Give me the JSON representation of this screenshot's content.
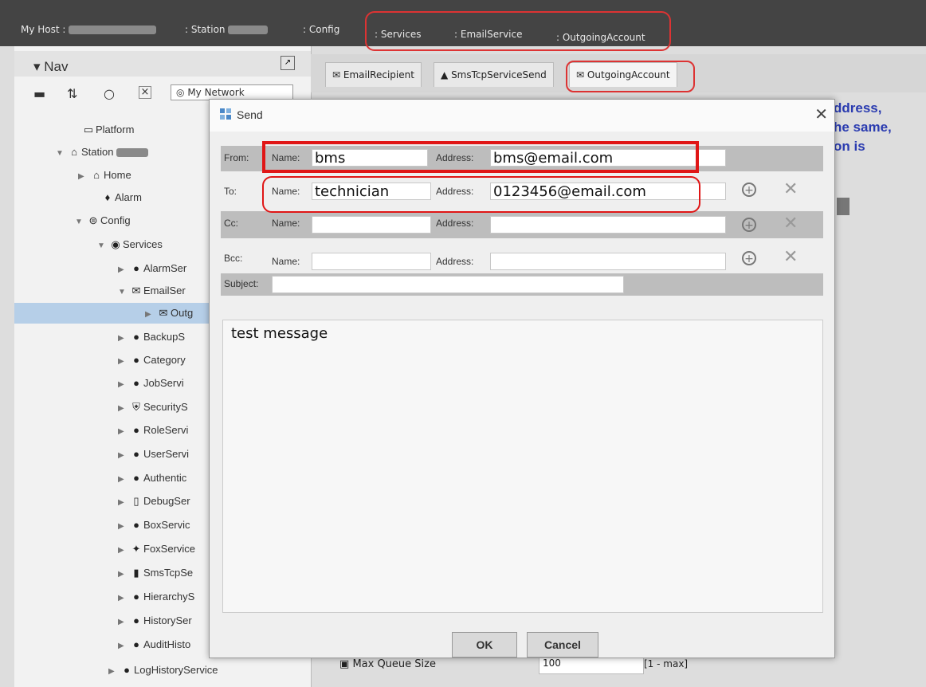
{
  "topbar": {
    "my_host": "My Host :",
    "station": ": Station",
    "config": ": Config",
    "services": ": Services",
    "email_service": ": EmailService",
    "outgoing_account": ": OutgoingAccount"
  },
  "nav": {
    "title": "Nav",
    "network": "My Network",
    "tree": [
      {
        "label": "Platform",
        "icon": "platform-icon"
      },
      {
        "label": "Station",
        "icon": "station-icon"
      },
      {
        "label": "Home",
        "icon": "home-icon"
      },
      {
        "label": "Alarm",
        "icon": "alarm-icon"
      },
      {
        "label": "Config",
        "icon": "config-icon"
      },
      {
        "label": "Services",
        "icon": "services-icon"
      },
      {
        "label": "AlarmSer",
        "icon": "service-icon"
      },
      {
        "label": "EmailSer",
        "icon": "email-icon"
      },
      {
        "label": "Outg",
        "icon": "outgoing-account-icon"
      },
      {
        "label": "BackupS",
        "icon": "service-icon"
      },
      {
        "label": "Category",
        "icon": "service-icon"
      },
      {
        "label": "JobServi",
        "icon": "service-icon"
      },
      {
        "label": "SecurityS",
        "icon": "shield-icon"
      },
      {
        "label": "RoleServi",
        "icon": "service-icon"
      },
      {
        "label": "UserServi",
        "icon": "service-icon"
      },
      {
        "label": "Authentic",
        "icon": "service-icon"
      },
      {
        "label": "DebugSer",
        "icon": "debug-icon"
      },
      {
        "label": "BoxServic",
        "icon": "service-icon"
      },
      {
        "label": "FoxService",
        "icon": "fox-icon"
      },
      {
        "label": "SmsTcpSe",
        "icon": "phone-icon"
      },
      {
        "label": "HierarchyS",
        "icon": "service-icon"
      },
      {
        "label": "HistorySer",
        "icon": "service-icon"
      },
      {
        "label": "AuditHisto",
        "icon": "service-icon"
      },
      {
        "label": "LogHistoryService",
        "icon": "service-icon"
      }
    ]
  },
  "tabs": [
    {
      "label": "EmailRecipient"
    },
    {
      "label": "SmsTcpServiceSend"
    },
    {
      "label": "OutgoingAccount"
    }
  ],
  "background": {
    "side_text": [
      "ddress,",
      "he same,",
      "on is"
    ],
    "max_queue_label": "Max Queue Size",
    "max_queue_value": "100",
    "max_queue_range": "[1 - max]"
  },
  "dialog": {
    "title": "Send",
    "from_label": "From:",
    "to_label": "To:",
    "cc_label": "Cc:",
    "bcc_label": "Bcc:",
    "subject_label": "Subject:",
    "name_label": "Name:",
    "address_label": "Address:",
    "from_name": "bms",
    "from_address": "bms@email.com",
    "to_name": "technician",
    "to_address": "0123456@email.com",
    "cc_name": "",
    "cc_address": "",
    "bcc_name": "",
    "bcc_address": "",
    "subject": "",
    "message": "test message",
    "ok_label": "OK",
    "cancel_label": "Cancel"
  },
  "colors": {
    "highlight_red": "#e01616",
    "link_blue": "#2a3bb0"
  }
}
